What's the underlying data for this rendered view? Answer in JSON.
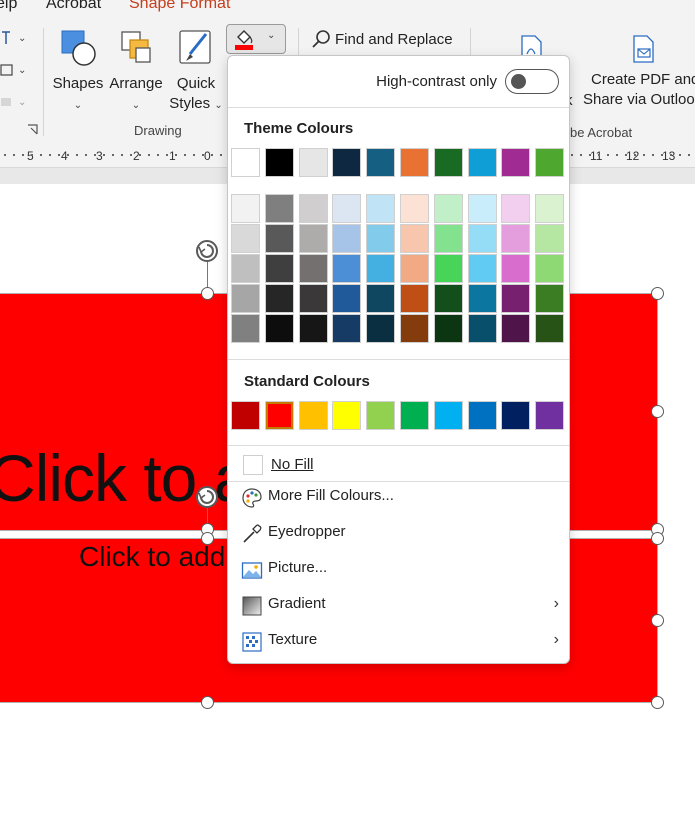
{
  "tabs": {
    "help": "elp",
    "acrobat": "Acrobat",
    "shape_format": "Shape Format"
  },
  "ribbon": {
    "drawing": {
      "group_label": "Drawing",
      "shapes_label": "Shapes",
      "arrange_label": "Arrange",
      "quick_styles_line1": "Quick",
      "quick_styles_line2": "Styles"
    },
    "find_replace_label": "Find and Replace",
    "create_pdf_line1": "Create PDF and",
    "create_pdf_line2": "Share via Outlook",
    "partial_k": "k",
    "acrobat_group_label": "be Acrobat",
    "fill_color": "#ff0000"
  },
  "ruler": {
    "left_numbers": [
      "5",
      "4",
      "3",
      "2",
      "1",
      "0"
    ],
    "right_numbers": [
      "11",
      "12",
      "13"
    ]
  },
  "slide": {
    "title_placeholder": "Click to a",
    "subtitle_placeholder": "Click to add",
    "shape_fill": "#ff0000"
  },
  "dropdown": {
    "high_contrast_label": "High-contrast only",
    "theme_colours_title": "Theme Colours",
    "theme_top": [
      "#ffffff",
      "#000000",
      "#e7e6e6",
      "#0e2841",
      "#156082",
      "#e97132",
      "#196b24",
      "#0f9ed5",
      "#a02b93",
      "#4ea72e"
    ],
    "theme_shades": [
      [
        "#f2f2f2",
        "#7f7f7f",
        "#d0cece",
        "#dce6f2",
        "#c0e4f5",
        "#fbe2d5",
        "#c1f0c8",
        "#caedfb",
        "#f2cfee",
        "#daf2d0"
      ],
      [
        "#d9d9d9",
        "#595959",
        "#aeabab",
        "#a6c4e8",
        "#83cbeb",
        "#f7c6ac",
        "#83e28e",
        "#95dcf7",
        "#e49edd",
        "#b5e6a2"
      ],
      [
        "#bfbfbf",
        "#3f3f3f",
        "#757070",
        "#4d8fd6",
        "#44b0e1",
        "#f2aa84",
        "#47d459",
        "#61cbf3",
        "#d86dcd",
        "#8ed973"
      ],
      [
        "#a6a6a6",
        "#262626",
        "#3a3838",
        "#215a9b",
        "#0f4761",
        "#c04f15",
        "#124f1a",
        "#0b76a0",
        "#782070",
        "#3a7d22"
      ],
      [
        "#808080",
        "#0d0d0d",
        "#171616",
        "#163b65",
        "#0a2f40",
        "#843c0c",
        "#0c3511",
        "#074f6a",
        "#4f154b",
        "#275317"
      ]
    ],
    "standard_colours_title": "Standard Colours",
    "standard": [
      "#c00000",
      "#ff0000",
      "#ffc000",
      "#ffff00",
      "#92d050",
      "#00b050",
      "#00b0f0",
      "#0070c0",
      "#002060",
      "#7030a0"
    ],
    "no_fill": "No Fill",
    "more_fill_colours": "More Fill Colours...",
    "eyedropper": "Eyedropper",
    "picture": "Picture...",
    "gradient": "Gradient",
    "texture": "Texture"
  }
}
